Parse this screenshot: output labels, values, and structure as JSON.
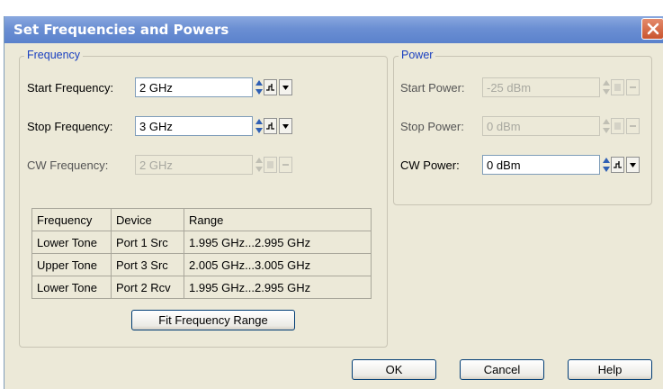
{
  "dialog": {
    "title": "Set Frequencies and Powers"
  },
  "frequency": {
    "legend": "Frequency",
    "start_label": "Start Frequency:",
    "start_value": "2 GHz",
    "stop_label": "Stop Frequency:",
    "stop_value": "3 GHz",
    "cw_label": "CW Frequency:",
    "cw_value": "2 GHz",
    "table": {
      "headers": [
        "Frequency",
        "Device",
        "Range"
      ],
      "rows": [
        [
          "Lower Tone",
          "Port 1 Src",
          "1.995 GHz...2.995 GHz"
        ],
        [
          "Upper Tone",
          "Port 3 Src",
          "2.005 GHz...3.005 GHz"
        ],
        [
          "Lower Tone",
          "Port 2 Rcv",
          "1.995 GHz...2.995 GHz"
        ]
      ]
    },
    "fit_button": "Fit Frequency Range"
  },
  "power": {
    "legend": "Power",
    "start_label": "Start Power:",
    "start_value": "-25 dBm",
    "stop_label": "Stop Power:",
    "stop_value": "0 dBm",
    "cw_label": "CW Power:",
    "cw_value": "0 dBm"
  },
  "buttons": {
    "ok": "OK",
    "cancel": "Cancel",
    "help": "Help"
  },
  "colors": {
    "title_bar": "#6b8fd3",
    "legend_text": "#1a40c0",
    "dialog_bg": "#ece9d8"
  },
  "icons": [
    "close-icon",
    "spin-arrows-icon",
    "step-icon",
    "dropdown-arrow-icon"
  ]
}
